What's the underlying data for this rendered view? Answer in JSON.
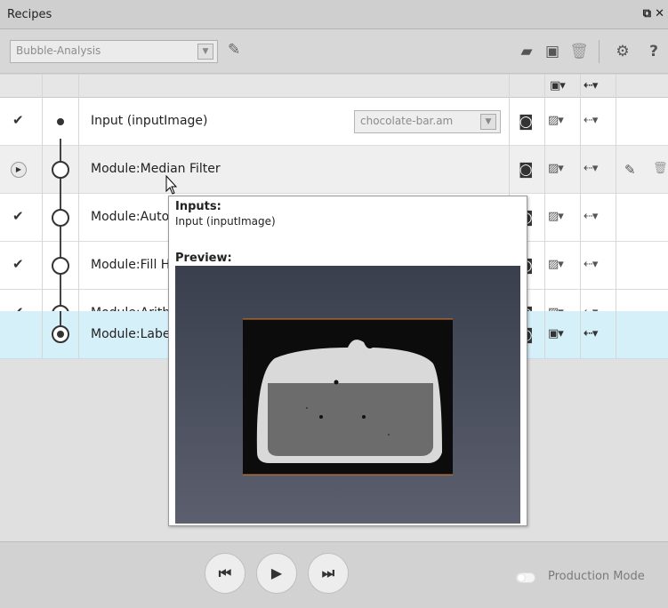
{
  "window": {
    "title": "Recipes",
    "float_icon": "restore-icon",
    "close_icon": "close-icon"
  },
  "toolbar": {
    "recipe_selected": "Bubble-Analysis",
    "icons": [
      "edit-icon",
      "open-folder-icon",
      "save-icon",
      "delete-icon",
      "settings-icon",
      "help-icon"
    ],
    "help_label": "?"
  },
  "rows": [
    {
      "status": "done",
      "label": "Input (inputImage)",
      "input_value": "chocolate-bar.am",
      "kind": "input"
    },
    {
      "status": "run",
      "label": "Module:Median Filter",
      "kind": "module"
    },
    {
      "status": "done",
      "label": "Module:Auto",
      "kind": "module"
    },
    {
      "status": "done",
      "label": "Module:Fill H",
      "kind": "module"
    },
    {
      "status": "done",
      "label": "Module:Arith",
      "kind": "module"
    },
    {
      "status": "current",
      "label": "Module:Labe",
      "kind": "module"
    }
  ],
  "tooltip": {
    "inputs_heading": "Inputs:",
    "inputs_value": "Input (inputImage)",
    "preview_heading": "Preview:"
  },
  "bottom": {
    "buttons": [
      "skip-back-icon",
      "play-icon",
      "skip-forward-icon"
    ],
    "production_label": "Production Mode"
  }
}
